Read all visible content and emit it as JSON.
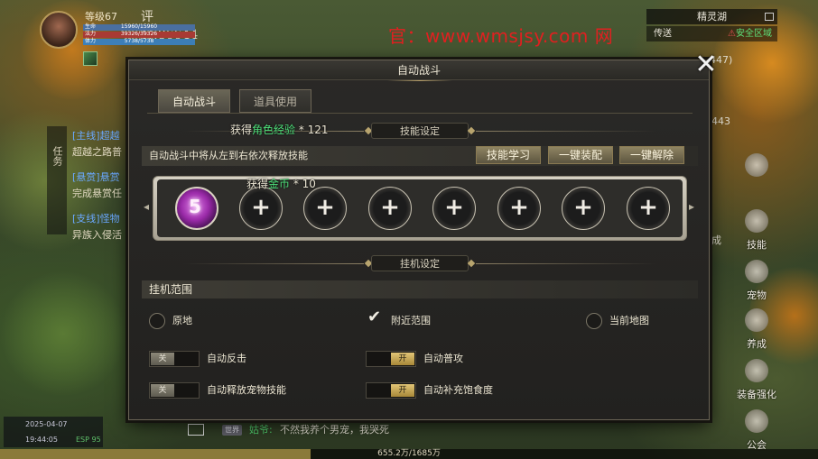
{
  "hud": {
    "level": "等级67",
    "rating": "评分:86644",
    "hp_label": "生命",
    "hp_text": "15960/15960",
    "mp_label": "法力",
    "mp_text": "39326/39326",
    "ep_label": "体力",
    "ep_text": "5738/5738",
    "watermark": "官：www.wmsjsy.com 网"
  },
  "minimap": {
    "name": "精灵湖",
    "teleport": "传送",
    "safe_zone": "安全区域",
    "side_num_1": "447)",
    "side_num_2": "443"
  },
  "tasks": {
    "tab_label": "任务",
    "items": [
      {
        "tag": "[主线]超越",
        "desc": "超越之路普"
      },
      {
        "tag": "[悬赏]悬赏",
        "desc": "完成悬赏任"
      },
      {
        "tag": "[支线]怪物",
        "desc": "异族入侵活"
      }
    ]
  },
  "sidemenu": {
    "skill": "技能",
    "pet": "宠物",
    "grow": "养成",
    "equip": "装备强化",
    "guild": "公会",
    "achieve": "成"
  },
  "status": {
    "date": "2025-04-07",
    "time": "19:44:05",
    "battery": "ESP 95"
  },
  "chat": {
    "channel": "世界",
    "speaker": "姑爷:",
    "message": "不然我养个男宠，我哭死"
  },
  "exp": {
    "text": "655.2万/1685万"
  },
  "dialog": {
    "title": "自动战斗",
    "close": "✕",
    "tabs": [
      "自动战斗",
      "道具使用"
    ],
    "skill_section": "技能设定",
    "skill_desc": "自动战斗中将从左到右依次释放技能",
    "btn_learn": "技能学习",
    "btn_equip": "一键装配",
    "btn_unequip": "一键解除",
    "slot_filled_num": "5",
    "slot_plus": "+",
    "gain_exp_prefix": "获得",
    "gain_exp_item": "角色经验",
    "gain_exp_amount": " * 121",
    "gain_gold_prefix": "获得",
    "gain_gold_item": "金币",
    "gain_gold_amount": " * 10",
    "hangup_section": "挂机设定",
    "range_title": "挂机范围",
    "range_options": [
      {
        "label": "原地",
        "selected": false
      },
      {
        "label": "附近范围",
        "selected": true
      },
      {
        "label": "当前地图",
        "selected": false
      }
    ],
    "toggles": [
      {
        "label": "自动反击",
        "state": "关"
      },
      {
        "label": "自动普攻",
        "state": "开"
      },
      {
        "label": "自动释放宠物技能",
        "state": "关"
      },
      {
        "label": "自动补充饱食度",
        "state": "开"
      }
    ]
  }
}
